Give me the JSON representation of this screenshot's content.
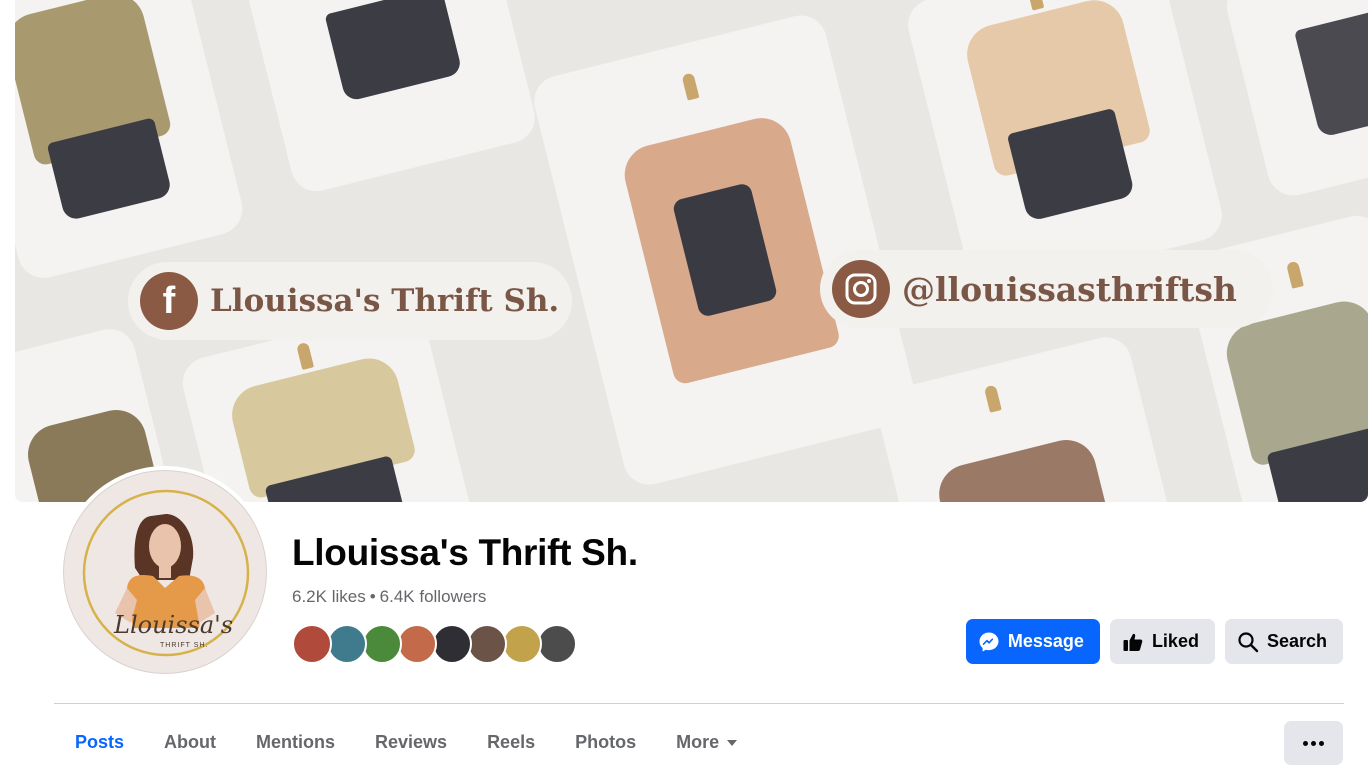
{
  "cover": {
    "facebook_label": "Llouissa's Thrift Sh.",
    "instagram_handle": "@llouissasthriftsh",
    "facebook_icon_text": "f"
  },
  "avatar": {
    "logo_text": "Llouissa's",
    "logo_subtext": "THRIFT SH."
  },
  "page": {
    "title": "Llouissa's Thrift Sh.",
    "likes": "6.2K likes",
    "separator": "•",
    "followers": "6.4K followers"
  },
  "friends": [
    {
      "color": "#b04a3a"
    },
    {
      "color": "#3f7b8c"
    },
    {
      "color": "#4a8a3a"
    },
    {
      "color": "#c26a4a"
    },
    {
      "color": "#2e2e34"
    },
    {
      "color": "#6b5447"
    },
    {
      "color": "#c2a24a"
    },
    {
      "color": "#4c4c4c"
    }
  ],
  "actions": {
    "message": "Message",
    "liked": "Liked",
    "search": "Search"
  },
  "tabs": [
    {
      "label": "Posts"
    },
    {
      "label": "About"
    },
    {
      "label": "Mentions"
    },
    {
      "label": "Reviews"
    },
    {
      "label": "Reels"
    },
    {
      "label": "Photos"
    },
    {
      "label": "More"
    }
  ],
  "colors": {
    "accent": "#0866ff",
    "secondary_button": "#e4e6eb",
    "muted_text": "#65676b",
    "cover_brown": "#8b5a44"
  }
}
